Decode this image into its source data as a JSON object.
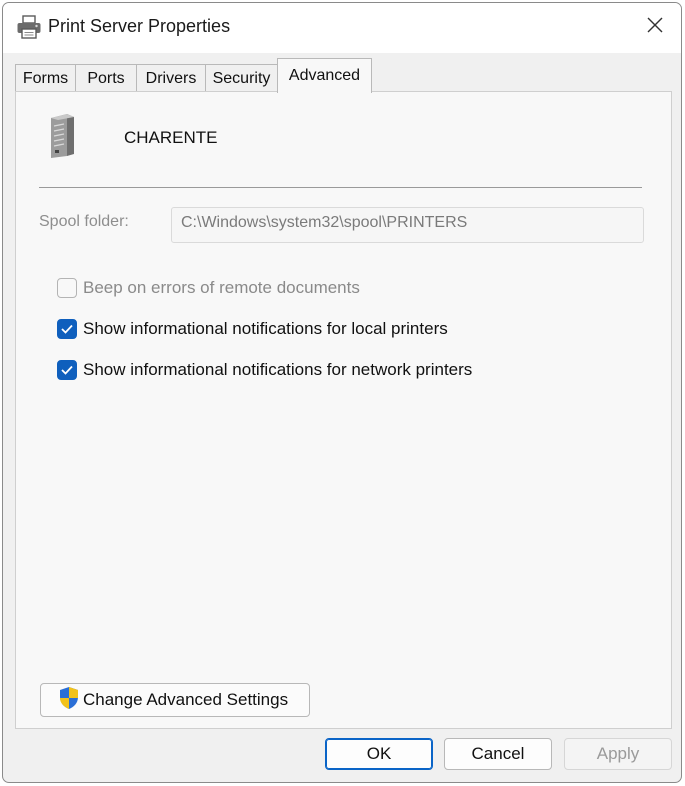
{
  "window": {
    "title": "Print Server Properties",
    "title_icon": "printer-icon",
    "close_icon": "close-icon"
  },
  "tabs": [
    {
      "label": "Forms",
      "active": false
    },
    {
      "label": "Ports",
      "active": false
    },
    {
      "label": "Drivers",
      "active": false
    },
    {
      "label": "Security",
      "active": false
    },
    {
      "label": "Advanced",
      "active": true
    }
  ],
  "server": {
    "name": "CHARENTE",
    "icon": "server-icon"
  },
  "spool": {
    "label": "Spool folder:",
    "value": "C:\\Windows\\system32\\spool\\PRINTERS"
  },
  "options": [
    {
      "label": "Beep on errors of remote documents",
      "checked": false,
      "enabled": false
    },
    {
      "label": "Show informational notifications for local printers",
      "checked": true,
      "enabled": true
    },
    {
      "label": "Show informational notifications for network printers",
      "checked": true,
      "enabled": true
    }
  ],
  "advanced_button": {
    "label": "Change Advanced Settings",
    "icon": "uac-shield-icon"
  },
  "buttons": {
    "ok": "OK",
    "cancel": "Cancel",
    "apply": "Apply"
  },
  "colors": {
    "accent": "#0f5fbd",
    "window_bg": "#f0f0f0"
  }
}
